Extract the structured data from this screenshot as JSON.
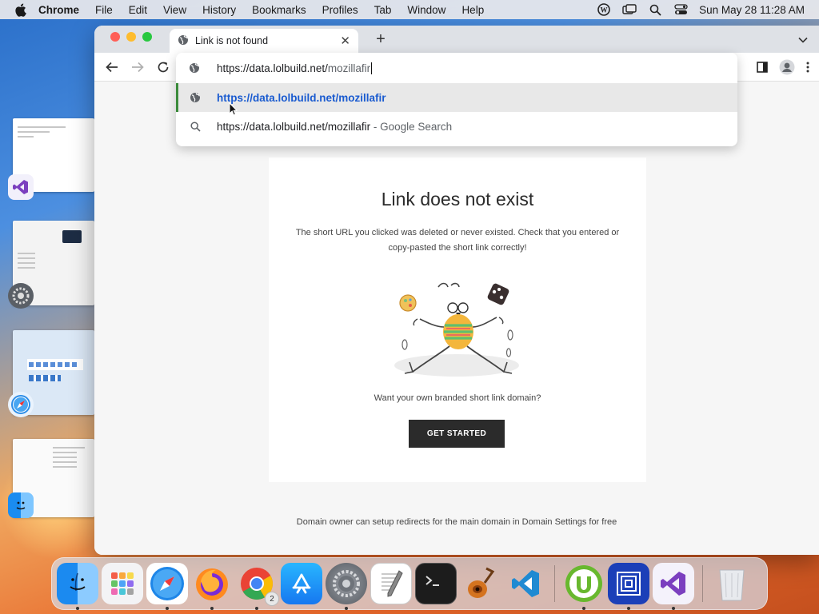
{
  "menubar": {
    "app_name": "Chrome",
    "items": [
      "File",
      "Edit",
      "View",
      "History",
      "Bookmarks",
      "Profiles",
      "Tab",
      "Window",
      "Help"
    ],
    "clock": "Sun May 28  11:28 AM"
  },
  "browser": {
    "tab_title": "Link is not found",
    "omnibox": {
      "url_host": "https://data.lolbuild.net/",
      "url_rest": "mozillafir",
      "suggestions": [
        {
          "text": "https://data.lolbuild.net/mozillafir",
          "suffix": "",
          "icon": "globe-icon",
          "selected": true
        },
        {
          "text": "https://data.lolbuild.net/mozillafir",
          "suffix": " - Google Search",
          "icon": "search-icon",
          "selected": false
        }
      ]
    }
  },
  "page": {
    "heading": "Link does not exist",
    "description": "The short URL you clicked was deleted or never existed. Check that you entered or copy-pasted the short link correctly!",
    "promo": "Want your own branded short link domain?",
    "cta_label": "GET STARTED",
    "footnote": "Domain owner can setup redirects for the main domain in Domain Settings for free"
  },
  "dock": {
    "apps": [
      "finder",
      "launchpad",
      "safari",
      "firefox",
      "chrome",
      "app-store",
      "system-settings",
      "textedit",
      "terminal",
      "garageband",
      "vscode",
      "utorrent",
      "sequence",
      "visual-studio",
      "trash"
    ],
    "chrome_badge": "2"
  },
  "colors": {
    "cta_bg": "#2b2b2b",
    "suggestion_link": "#1a5bd0",
    "selected_bar": "#3a8a3a"
  }
}
